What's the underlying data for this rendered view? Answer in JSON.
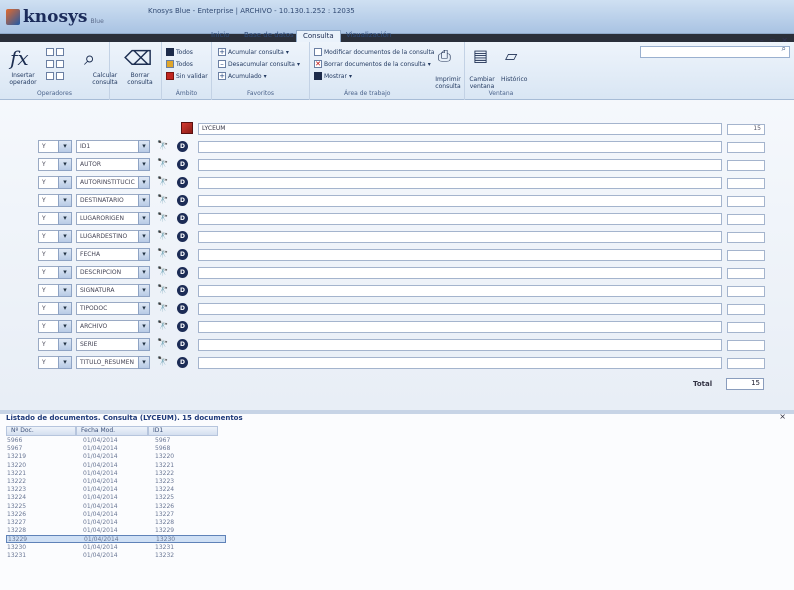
{
  "app": {
    "logo_text": "knosys",
    "logo_sub": "Blue",
    "title": "Knosys Blue - Enterprise  |  ARCHIVO - 10.130.1.252 : 12035"
  },
  "tabs": [
    "Inicio",
    "Base de datos",
    "Consulta",
    "Visualización"
  ],
  "ribbon": {
    "operadores": {
      "insertar": "Insertar operador",
      "label": "Operadores"
    },
    "consulta": {
      "calcular": "Calcular consulta",
      "borrar": "Borrar consulta"
    },
    "ambito": {
      "items": [
        "Todos",
        "Todos",
        "Sin validar"
      ],
      "label": "Ámbito"
    },
    "favoritos": {
      "items": [
        "Acumular consulta",
        "Desacumular consulta",
        "Acumulado"
      ],
      "label": "Favoritos"
    },
    "area": {
      "items": [
        "Modificar documentos de la consulta",
        "Borrar documentos de la consulta",
        "Mostrar"
      ],
      "imprimir": "Imprimir consulta",
      "label": "Área de trabajo"
    },
    "ventana": {
      "cambiar": "Cambiar ventana",
      "historico": "Histórico",
      "label": "Ventana"
    }
  },
  "query": {
    "base_value": "LYCEUM",
    "base_count": "15",
    "rows": [
      {
        "op": "Y",
        "field": "ID1"
      },
      {
        "op": "Y",
        "field": "AUTOR"
      },
      {
        "op": "Y",
        "field": "AUTORINSTITUCIC"
      },
      {
        "op": "Y",
        "field": "DESTINATARIO"
      },
      {
        "op": "Y",
        "field": "LUGARORIGEN"
      },
      {
        "op": "Y",
        "field": "LUGARDESTINO"
      },
      {
        "op": "Y",
        "field": "FECHA"
      },
      {
        "op": "Y",
        "field": "DESCRIPCION"
      },
      {
        "op": "Y",
        "field": "SIGNATURA"
      },
      {
        "op": "Y",
        "field": "TIPODOC"
      },
      {
        "op": "Y",
        "field": "ARCHIVO"
      },
      {
        "op": "Y",
        "field": "SERIE"
      },
      {
        "op": "Y",
        "field": "TITULO_RESUMEN"
      }
    ],
    "total_label": "Total",
    "total_value": "15"
  },
  "results": {
    "title": "Listado de documentos. Consulta (LYCEUM). 15 documentos",
    "columns": [
      "Nº Doc.",
      "Fecha Mod.",
      "ID1"
    ],
    "rows": [
      [
        "5966",
        "01/04/2014",
        "5967"
      ],
      [
        "5967",
        "01/04/2014",
        "5968"
      ],
      [
        "13219",
        "01/04/2014",
        "13220"
      ],
      [
        "13220",
        "01/04/2014",
        "13221"
      ],
      [
        "13221",
        "01/04/2014",
        "13222"
      ],
      [
        "13222",
        "01/04/2014",
        "13223"
      ],
      [
        "13223",
        "01/04/2014",
        "13224"
      ],
      [
        "13224",
        "01/04/2014",
        "13225"
      ],
      [
        "13225",
        "01/04/2014",
        "13226"
      ],
      [
        "13226",
        "01/04/2014",
        "13227"
      ],
      [
        "13227",
        "01/04/2014",
        "13228"
      ],
      [
        "13228",
        "01/04/2014",
        "13229"
      ],
      [
        "13229",
        "01/04/2014",
        "13230"
      ],
      [
        "13230",
        "01/04/2014",
        "13231"
      ],
      [
        "13231",
        "01/04/2014",
        "13232"
      ]
    ],
    "selected_row": 12
  }
}
